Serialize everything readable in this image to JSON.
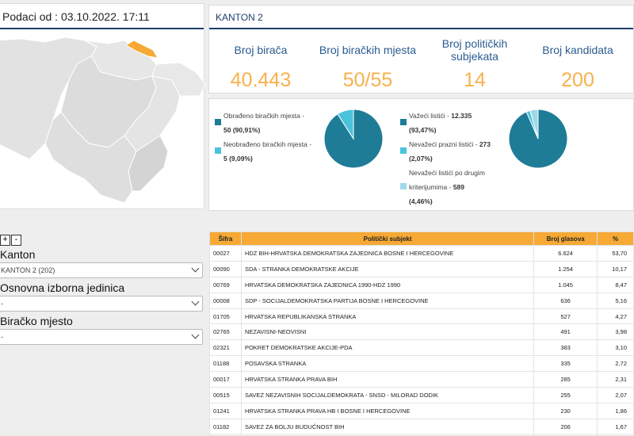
{
  "left": {
    "header": "Podaci od : 03.10.2022. 17:11",
    "zoom_in": "+",
    "zoom_out": "-",
    "filters": [
      {
        "label": "Kanton",
        "value": "KANTON 2 (202)"
      },
      {
        "label": "Osnovna izborna jedinica",
        "value": "-"
      },
      {
        "label": "Biračko mjesto",
        "value": "-"
      }
    ]
  },
  "summary": {
    "title": "KANTON 2",
    "stats": [
      {
        "label": "Broj birača",
        "value": "40.443"
      },
      {
        "label": "Broj biračkih mjesta",
        "value": "50/55"
      },
      {
        "label": "Broj političkih subjekata",
        "value": "14"
      },
      {
        "label": "Broj kandidata",
        "value": "200"
      }
    ]
  },
  "pies": {
    "processed": {
      "items": [
        {
          "label": "Obrađeno biračkih mjesta -",
          "value": "50 (90,91%)",
          "color": "#1f7c96",
          "fraction": 0.9091
        },
        {
          "label": "Neobrađeno biračkih mjesta -",
          "value": "5 (9,09%)",
          "color": "#4cc3dc",
          "fraction": 0.0909
        }
      ]
    },
    "ballots": {
      "valid_label": "Važeći listići -",
      "valid_value": "12.335",
      "valid_pct": "(93,47%)",
      "empty_label": "Nevažeći prazni listići -",
      "empty_value": "273",
      "empty_pct": "(2,07%)",
      "other_label1": "Nevažeći listići po drugim",
      "other_label2": "kriterijumima -",
      "other_value": "589",
      "other_pct": "(4,46%)",
      "colors": [
        "#1f7c96",
        "#4cc3dc",
        "#9fd9ea"
      ],
      "fractions": [
        0.9347,
        0.0207,
        0.0446
      ]
    }
  },
  "table": {
    "headers": {
      "code": "Šifra",
      "subject": "Politički subjekt",
      "votes": "Broj glasova",
      "pct": "%"
    },
    "rows": [
      {
        "code": "00027",
        "subject": "HDZ BIH-HRVATSKA DEMOKRATSKA ZAJEDNICA BOSNE I HERCEGOVINE",
        "votes": "6.624",
        "pct": "53,70"
      },
      {
        "code": "00090",
        "subject": "SDA - STRANKA DEMOKRATSKE AKCIJE",
        "votes": "1.254",
        "pct": "10,17"
      },
      {
        "code": "00769",
        "subject": "HRVATSKA DEMOKRATSKA ZAJEDNICA 1990-HDZ 1990",
        "votes": "1.045",
        "pct": "8,47"
      },
      {
        "code": "00008",
        "subject": "SDP - SOCIJALDEMOKRATSKA PARTIJA BOSNE I HERCEGOVINE",
        "votes": "636",
        "pct": "5,16"
      },
      {
        "code": "01705",
        "subject": "HRVATSKA REPUBLIKANSKA STRANKA",
        "votes": "527",
        "pct": "4,27"
      },
      {
        "code": "02765",
        "subject": "NEZAVISNI-NEOVISNI",
        "votes": "491",
        "pct": "3,98"
      },
      {
        "code": "02321",
        "subject": "POKRET DEMOKRATSKE AKCIJE-PDA",
        "votes": "383",
        "pct": "3,10"
      },
      {
        "code": "01188",
        "subject": "POSAVSKA STRANKA",
        "votes": "335",
        "pct": "2,72"
      },
      {
        "code": "00017",
        "subject": "HRVATSKA STRANKA PRAVA BIH",
        "votes": "285",
        "pct": "2,31"
      },
      {
        "code": "00515",
        "subject": "SAVEZ NEZAVISNIH SOCIJALDEMOKRATA - SNSD - MILORAD DODIK",
        "votes": "255",
        "pct": "2,07"
      },
      {
        "code": "01241",
        "subject": "HRVATSKA STRANKA PRAVA HB I BOSNE I HERCEGOVINE",
        "votes": "230",
        "pct": "1,86"
      },
      {
        "code": "01182",
        "subject": "SAVEZ ZA BOLJU BUDUĆNOST BIH",
        "votes": "206",
        "pct": "1,67"
      }
    ]
  }
}
